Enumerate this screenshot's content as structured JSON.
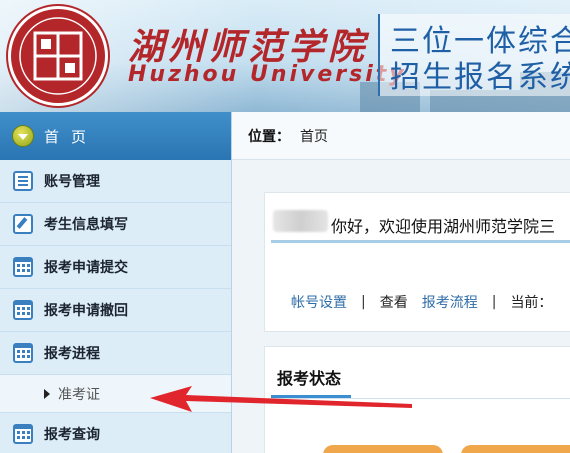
{
  "banner": {
    "logo_text": "湖州师范学院",
    "university_cn": "湖州师范学院",
    "university_en": "Huzhou University",
    "system_line1": "三位一体综合",
    "system_line2": "招生报名系统",
    "brand_color": "#b3262a",
    "system_color": "#1f5fa5"
  },
  "sidebar": {
    "home_label": "首页",
    "items": [
      {
        "label": "账号管理",
        "icon": "list-icon"
      },
      {
        "label": "考生信息填写",
        "icon": "edit-icon"
      },
      {
        "label": "报考申请提交",
        "icon": "calendar-icon"
      },
      {
        "label": "报考申请撤回",
        "icon": "calendar-icon"
      },
      {
        "label": "报考进程",
        "icon": "calendar-icon"
      },
      {
        "label": "报考查询",
        "icon": "calendar-icon"
      }
    ],
    "submenu": [
      {
        "label": "准考证"
      }
    ],
    "accent_color": "#2a75b3"
  },
  "breadcrumb": {
    "label": "位置：",
    "value": "首页"
  },
  "welcome": {
    "text": "你好，欢迎使用湖州师范学院三",
    "links": {
      "account_settings": "帐号设置",
      "sep1": "|",
      "view": "查看",
      "process": "报考流程",
      "sep2": "|",
      "current": "当前："
    }
  },
  "status": {
    "title": "报考状态"
  }
}
